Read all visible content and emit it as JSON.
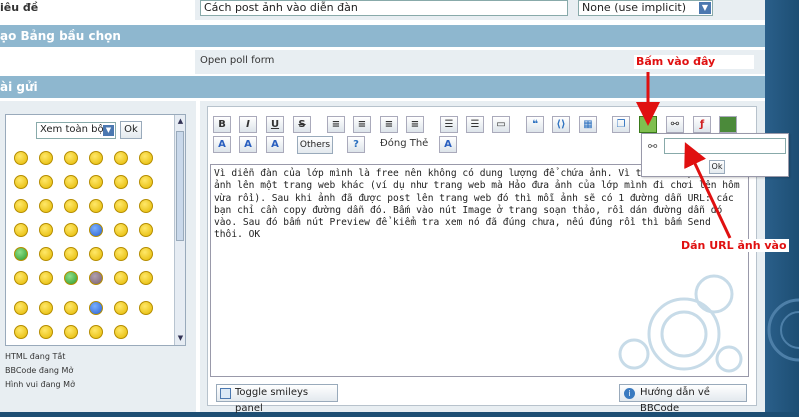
{
  "form": {
    "title_label": "iêu đề",
    "title_value": "Cách post ảnh vào diễn đàn",
    "icon_select_value": "None (use implicit)"
  },
  "poll": {
    "header": "ạo Bảng bầu chọn",
    "open_poll_link": "Open poll form"
  },
  "post": {
    "header": "ài gửi"
  },
  "smilies": {
    "select_value": "Xem toàn bộ",
    "ok_label": "Ok"
  },
  "status": {
    "html": "HTML đang Tắt",
    "bbcode": "BBCode đang Mở",
    "smilies": "Hình vui đang Mở"
  },
  "toolbar": {
    "bold": "B",
    "italic": "I",
    "underline": "U",
    "strike": "S",
    "others_label": "Others",
    "font_label": "Đóng Thẻ"
  },
  "editor": {
    "content": "Vì diễn đàn của lớp mình là free nên không có dung lượng để chứa ảnh. Vì thế mình phải đưa ảnh lên một trang web khác (ví dụ như trang web mà Hảo đưa ảnh của lớp mình đi chơi lên hôm vừa rồi). Sau khi ảnh đã được post lên trang web đó thì mỗi ảnh sẽ có 1 đường dẫn URL: các bạn chỉ cần copy đường dẫn đó. Bấm vào nút Image ở trang soạn thảo, rồi dán đường dẫn đó vào. Sau đó bấm nút Preview để kiểm tra xem nó đã đúng chưa, nếu đúng rồi thì bấm Send thôi. OK"
  },
  "image_popup": {
    "ok_label": "Ok"
  },
  "annotations": {
    "click_here": "Bấm vào đây",
    "paste_url": "Dán URL ảnh vào"
  },
  "bottom": {
    "toggle_smileys": "Toggle smileys panel",
    "bbcode_help": "Hướng dẫn về BBCode"
  },
  "colors": {
    "section_bar": "#8eb7cf",
    "annotation_red": "#e01010",
    "page_background": "#1d4e73"
  }
}
